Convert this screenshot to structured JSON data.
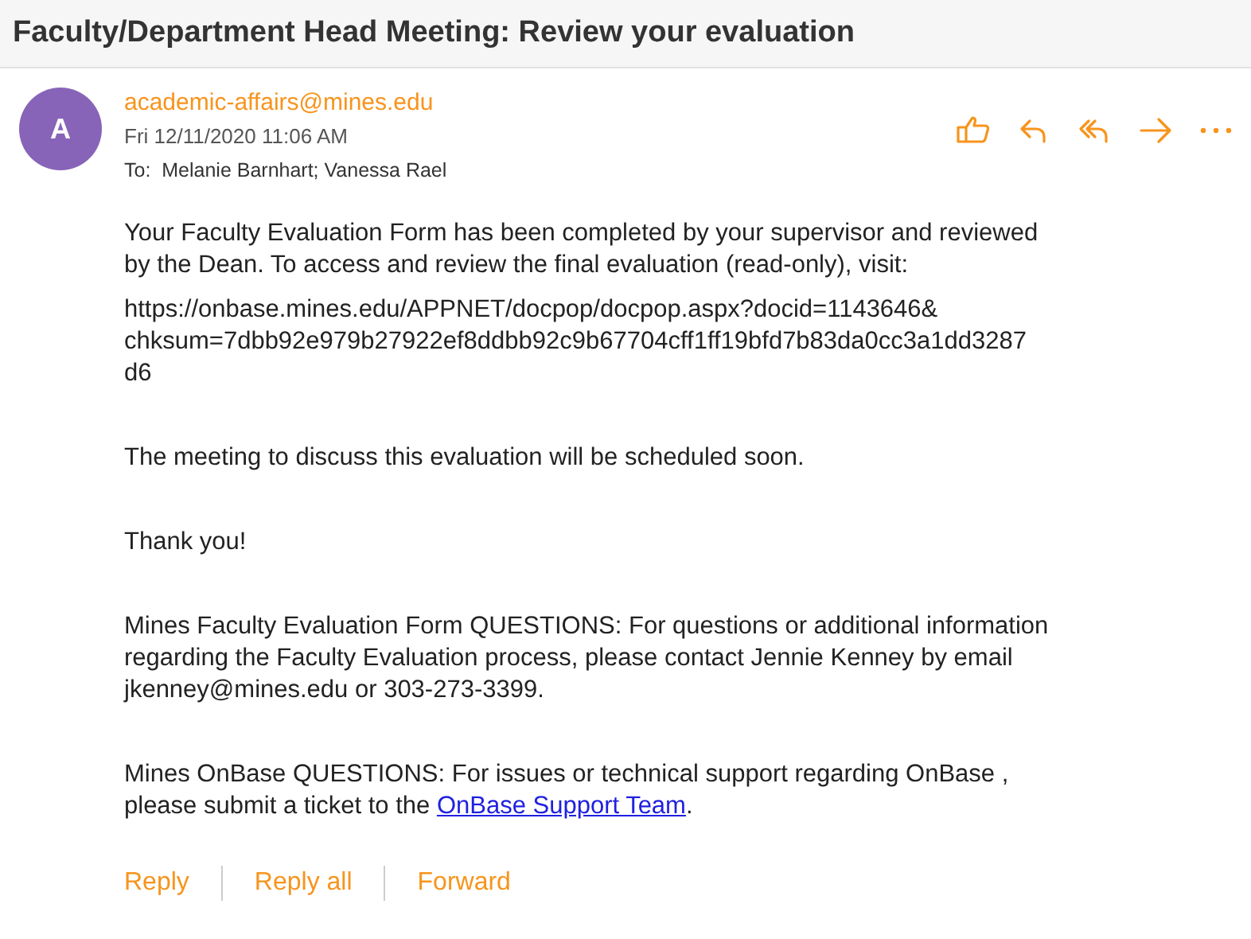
{
  "subject": "Faculty/Department Head Meeting: Review your evaluation",
  "message": {
    "avatar": "A",
    "sender": "academic-affairs@mines.edu",
    "date": "Fri 12/11/2020 11:06 AM",
    "to_label": "To:",
    "recipients": "Melanie Barnhart; Vanessa Rael"
  },
  "paragraphs": [
    {
      "lines": [
        "Your Faculty Evaluation Form has been completed by your supervisor and reviewed",
        "by the Dean. To access and review the final evaluation (read-only), visit:"
      ]
    },
    {
      "lines": [
        "https://onbase.mines.edu/APPNET/docpop/docpop.aspx?docid=1143646&",
        "chksum=7dbb92e979b27922ef8ddbb92c9b67704cff1ff19bfd7b83da0cc3a1dd3287",
        "d6"
      ]
    },
    {
      "lines": [
        "The meeting to discuss this evaluation will be scheduled soon."
      ]
    },
    {
      "lines": [
        "Thank you!"
      ]
    },
    {
      "lines": [
        "Mines Faculty Evaluation Form QUESTIONS: For questions or additional information",
        "regarding the Faculty Evaluation process, please contact Jennie Kenney by email",
        "jkenney@mines.edu or 303-273-3399."
      ]
    },
    {
      "lines": [
        "Mines OnBase QUESTIONS: For issues or technical support regarding OnBase ,",
        "please submit a ticket to the "
      ],
      "link": "OnBase Support Team",
      "after": "."
    }
  ],
  "actions": [
    "Reply",
    "Reply all",
    "Forward"
  ]
}
